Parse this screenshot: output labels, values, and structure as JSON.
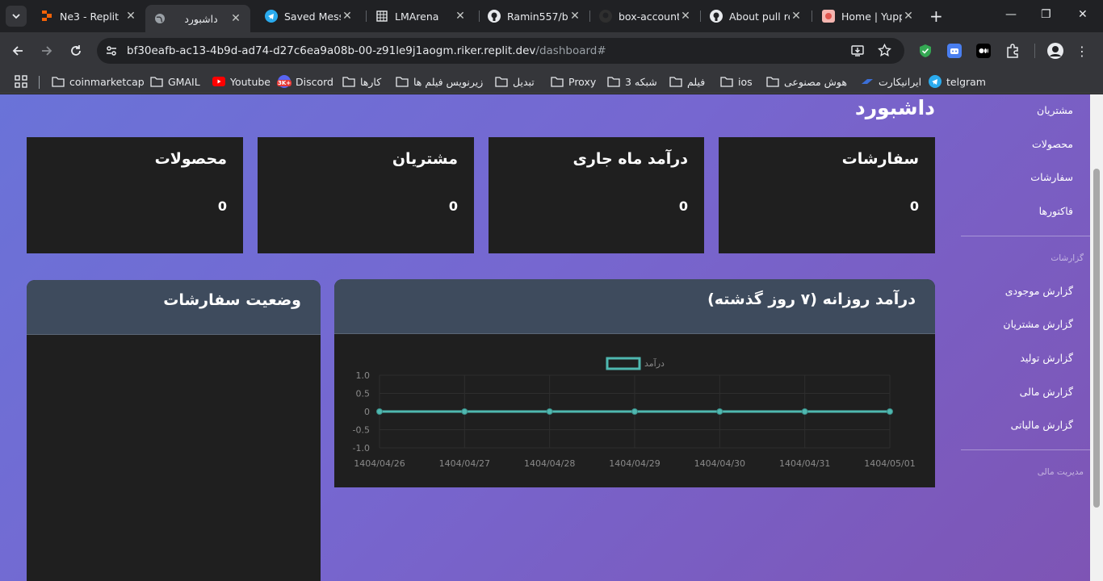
{
  "tabs": [
    {
      "title": "Ne3 - Replit",
      "icon": "replit-icon",
      "active": false
    },
    {
      "title": "داشبورد",
      "icon": "globe-icon",
      "active": true
    },
    {
      "title": "Saved Messa",
      "icon": "telegram-icon",
      "active": false
    },
    {
      "title": "LMArena",
      "icon": "table-icon",
      "active": false
    },
    {
      "title": "Ramin557/b",
      "icon": "github-icon",
      "active": false
    },
    {
      "title": "box-account",
      "icon": "github-icon",
      "active": false
    },
    {
      "title": "About pull re",
      "icon": "github-icon",
      "active": false
    },
    {
      "title": "Home | Yupp",
      "icon": "yupp-icon",
      "active": false
    }
  ],
  "address": {
    "host": "bf30eafb-ac13-4b9d-ad74-d27c6ea9a08b-00-z91le9j1aogm.riker.replit.dev",
    "path": "/dashboard#"
  },
  "bookmarks": [
    {
      "label": "coinmarketcap",
      "icon": "folder-icon"
    },
    {
      "label": "GMAIL",
      "icon": "folder-icon"
    },
    {
      "label": "Youtube",
      "icon": "youtube-icon"
    },
    {
      "label": "Discord",
      "icon": "discord-icon",
      "badge": "3K+"
    },
    {
      "label": "کارها",
      "icon": "folder-icon"
    },
    {
      "label": "زیرنویس فیلم ها",
      "icon": "folder-icon"
    },
    {
      "label": "تبدیل",
      "icon": "folder-icon"
    },
    {
      "label": "Proxy",
      "icon": "folder-icon"
    },
    {
      "label": "شبکه 3",
      "icon": "folder-icon"
    },
    {
      "label": "فیلم",
      "icon": "folder-icon"
    },
    {
      "label": "ios",
      "icon": "folder-icon"
    },
    {
      "label": "هوش مصنوعی",
      "icon": "folder-icon"
    },
    {
      "label": "ایرانیکارت",
      "icon": "iranicard-icon"
    },
    {
      "label": "telgram",
      "icon": "telegram-icon"
    }
  ],
  "page": {
    "title": "داشبورد",
    "stat_cards": [
      {
        "title": "سفارشات",
        "value": "0"
      },
      {
        "title": "درآمد ماه جاری",
        "value": "0"
      },
      {
        "title": "مشتریان",
        "value": "0"
      },
      {
        "title": "محصولات",
        "value": "0"
      }
    ],
    "revenue_panel_title": "درآمد روزانه (۷ روز گذشته)",
    "orders_panel_title": "وضعیت سفارشات"
  },
  "sidebar": {
    "items_top": [
      "مشتریان",
      "محصولات",
      "سفارشات",
      "فاکتورها"
    ],
    "reports_header": "گزارشات",
    "report_items": [
      "گزارش موجودی",
      "گزارش مشتریان",
      "گزارش تولید",
      "گزارش مالی",
      "گزارش مالیاتی"
    ],
    "finance_header": "مدیریت مالی"
  },
  "colors": {
    "series": "#4fb8b0",
    "accent": "#3e4b5d"
  },
  "chart_data": {
    "type": "line",
    "title": "",
    "categories": [
      "1404/04/26",
      "1404/04/27",
      "1404/04/28",
      "1404/04/29",
      "1404/04/30",
      "1404/04/31",
      "1404/05/01"
    ],
    "series": [
      {
        "name": "درآمد",
        "values": [
          0,
          0,
          0,
          0,
          0,
          0,
          0
        ]
      }
    ],
    "y_ticks": [
      "1.0",
      "0.5",
      "0",
      "-0.5",
      "-1.0"
    ],
    "ylim": [
      -1,
      1
    ],
    "grid": true,
    "legend": "top-center"
  }
}
